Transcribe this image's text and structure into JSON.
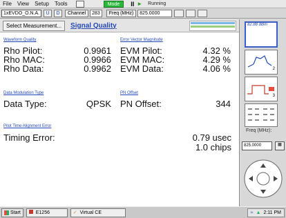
{
  "menu": {
    "items": [
      "File",
      "View",
      "Setup",
      "Tools"
    ],
    "mode_label": "Mode",
    "running": "Running"
  },
  "toolbar": {
    "mode_select": "1xEVDO_O.N.A. C",
    "channel_label": "Channel",
    "channel_value": "283",
    "freq_label": "Freq (MHz)",
    "freq_value": "825.0000"
  },
  "tabs": {
    "select_measurement": "Select Measurement...",
    "active": "Signal Quality"
  },
  "sections": {
    "waveform_quality": "Waveform Quality",
    "evm": "Error Vector Magnitude",
    "data_modulation": "Data Modulation Type",
    "pn_offset": "PN Offset",
    "pilot_time": "Pilot Time Alignment Error"
  },
  "metrics": {
    "rho_pilot": {
      "label": "Rho Pilot:",
      "value": "0.9961"
    },
    "rho_mac": {
      "label": "Rho MAC:",
      "value": "0.9966"
    },
    "rho_data": {
      "label": "Rho Data:",
      "value": "0.9962"
    },
    "evm_pilot": {
      "label": "EVM Pilot:",
      "value": "4.32 %"
    },
    "evm_mac": {
      "label": "EVM MAC:",
      "value": "4.29 %"
    },
    "evm_data": {
      "label": "EVM Data:",
      "value": "4.06 %"
    },
    "data_type": {
      "label": "Data Type:",
      "value": "QPSK"
    },
    "pn_offset": {
      "label": "PN Offset:",
      "value": "344"
    },
    "timing_error": {
      "label": "Timing Error:",
      "value_usec": "0.79 usec",
      "value_chips": "1.0 chips"
    }
  },
  "sidebar": {
    "thumb1_caption": "82.88 dBm",
    "thumb2_caption": "2",
    "thumb3_caption": "3",
    "freq_label": "Freq (MHz):",
    "freq_value": "825.0000"
  },
  "taskbar": {
    "start": "Start",
    "task1": "E1256",
    "task2": "Virtual CE",
    "clock": "2:11 PM"
  }
}
